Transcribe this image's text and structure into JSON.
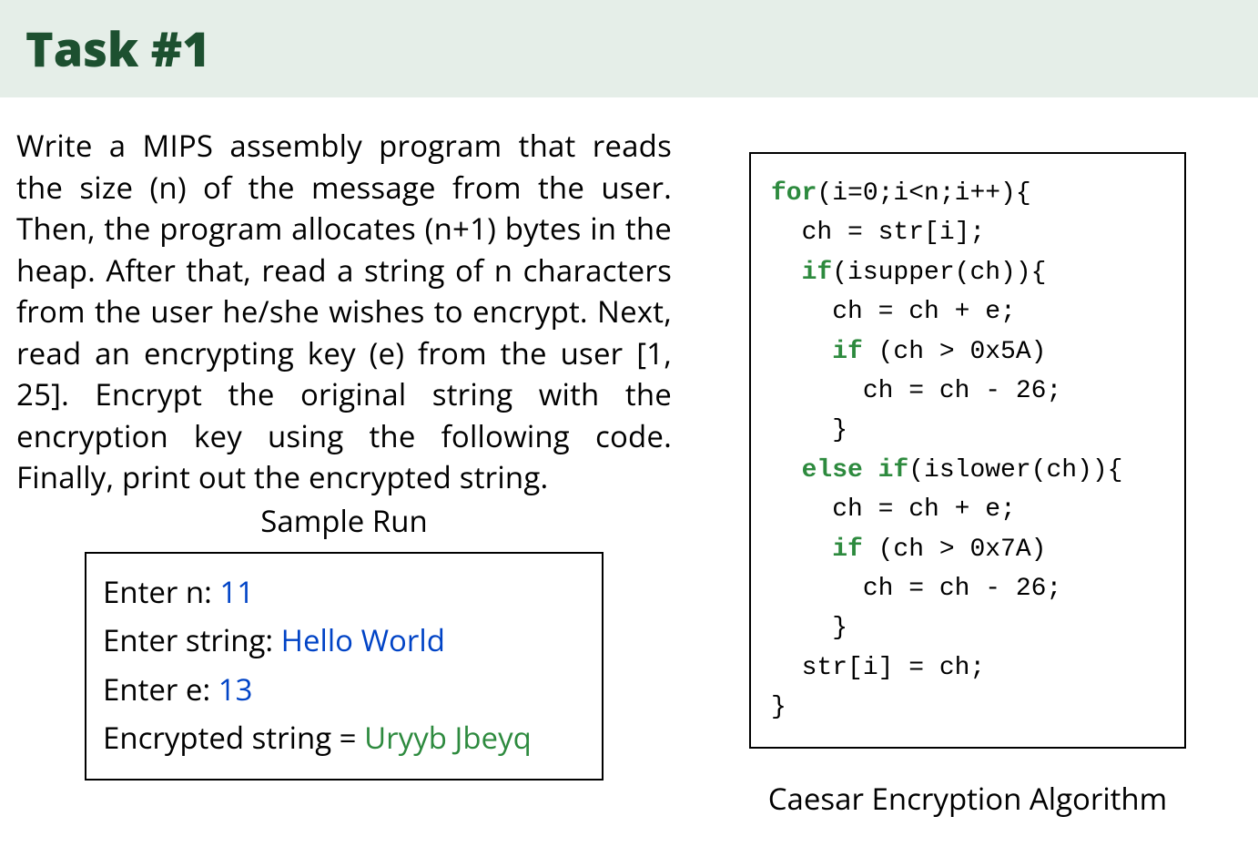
{
  "header": {
    "title": "Task #1"
  },
  "description": "Write a MIPS assembly program that reads the size (n) of the message from the user.  Then, the program allocates (n+1) bytes in the heap.  After that, read a string of n characters from the user he/she wishes to encrypt.  Next, read an encrypting key (e) from the user [1, 25].  Encrypt the original string with the encryption key using the following code. Finally, print out the encrypted string.",
  "sampleRun": {
    "title": "Sample Run",
    "lines": {
      "line1": {
        "prompt": "Enter n: ",
        "value": "11"
      },
      "line2": {
        "prompt": "Enter string: ",
        "value": "Hello World"
      },
      "line3": {
        "prompt": "Enter e: ",
        "value": "13"
      },
      "line4": {
        "prompt": "Encrypted string = ",
        "value": "Uryyb Jbeyq"
      }
    }
  },
  "code": {
    "l1_kw": "for",
    "l1_rest": "(i=0;i<n;i++){",
    "l2": "  ch = str[i];",
    "l3_kw": "  if",
    "l3_rest": "(isupper(ch)){",
    "l4": "    ch = ch + e;",
    "l5_kw": "    if",
    "l5_rest": " (ch > 0x5A)",
    "l6": "      ch = ch - 26;",
    "l7": "    }",
    "l8_kw1": "  else ",
    "l8_kw2": "if",
    "l8_rest": "(islower(ch)){",
    "l9": "    ch = ch + e;",
    "l10_kw": "    if",
    "l10_rest": " (ch > 0x7A)",
    "l11": "      ch = ch - 26;",
    "l12": "    }",
    "l13": "  str[i] = ch;",
    "l14": "}"
  },
  "caption": "Caesar Encryption Algorithm"
}
